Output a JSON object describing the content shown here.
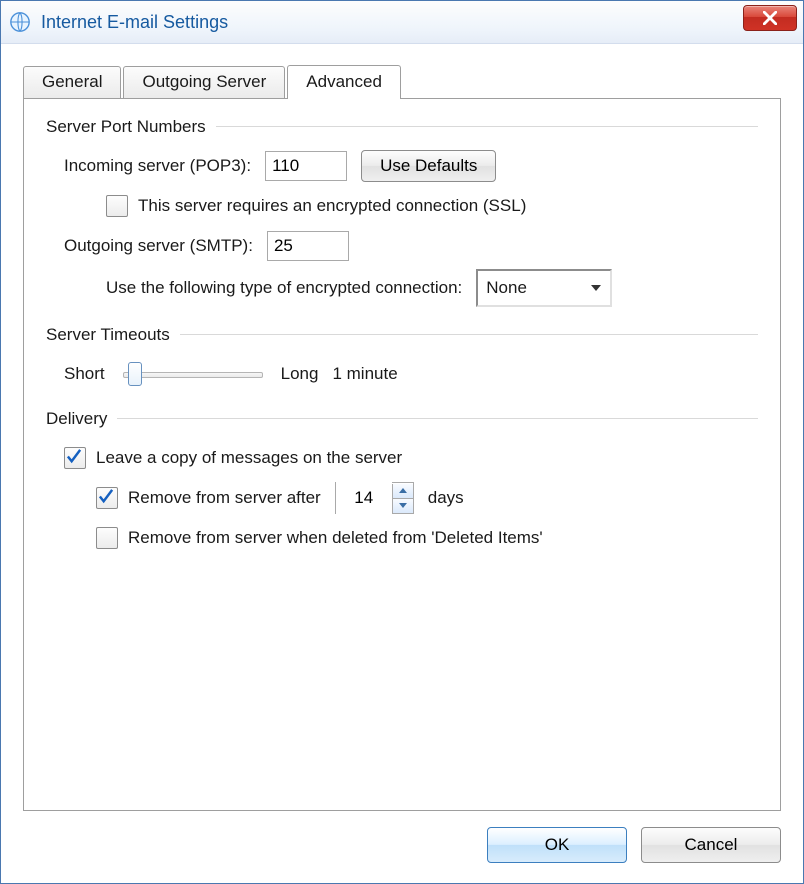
{
  "title": "Internet E-mail Settings",
  "tabs": {
    "general": "General",
    "outgoing": "Outgoing Server",
    "advanced": "Advanced"
  },
  "groups": {
    "ports": {
      "title": "Server Port Numbers",
      "incoming_label": "Incoming server (POP3):",
      "incoming_value": "110",
      "use_defaults": "Use Defaults",
      "ssl_label": "This server requires an encrypted connection (SSL)",
      "outgoing_label": "Outgoing server (SMTP):",
      "outgoing_value": "25",
      "enc_label": "Use the following type of encrypted connection:",
      "enc_value": "None"
    },
    "timeouts": {
      "title": "Server Timeouts",
      "short": "Short",
      "long": "Long",
      "value": "1 minute"
    },
    "delivery": {
      "title": "Delivery",
      "leave_copy": "Leave a copy of messages on the server",
      "remove_after": "Remove from server after",
      "remove_after_days": "14",
      "days_label": "days",
      "remove_deleted": "Remove from server when deleted from 'Deleted Items'"
    }
  },
  "buttons": {
    "ok": "OK",
    "cancel": "Cancel"
  }
}
